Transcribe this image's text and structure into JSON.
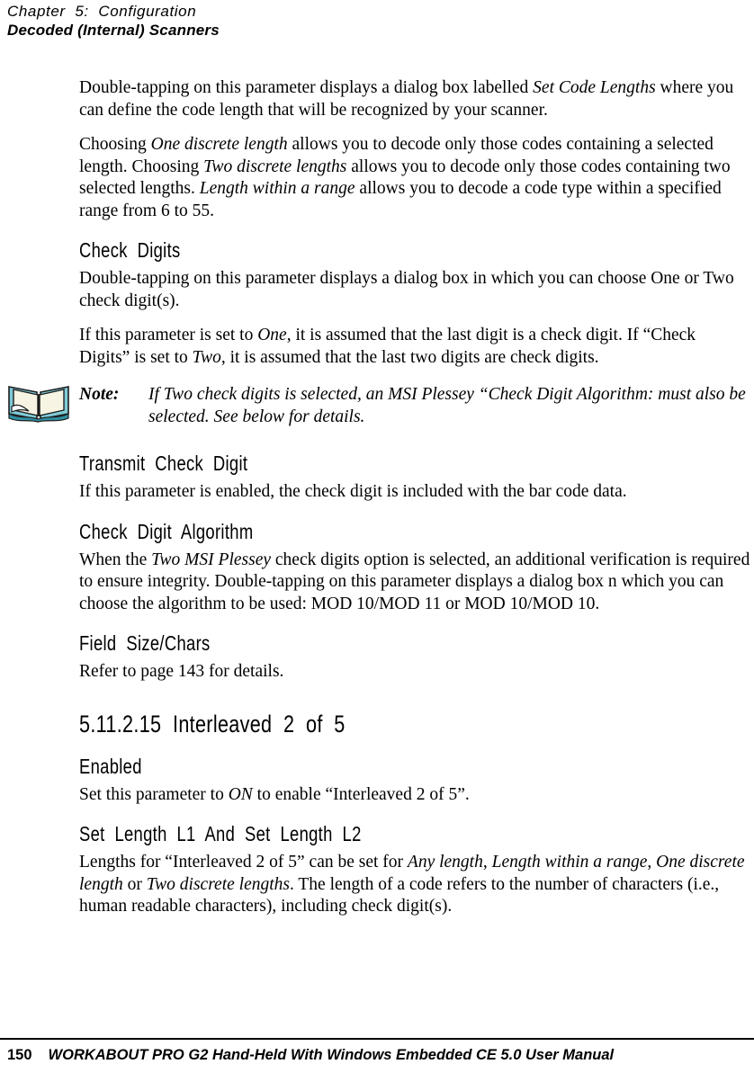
{
  "header": {
    "chapter": "Chapter  5:  Configuration",
    "subject": "Decoded (Internal) Scanners"
  },
  "content": {
    "intro_paragraph_1": {
      "part1": "Double-tapping on this parameter displays a dialog box labelled ",
      "em1": "Set Code Lengths",
      "part2": " where you can define the code length that will be recognized by your scanner."
    },
    "intro_paragraph_2": {
      "part1": "Choosing ",
      "em1": "One discrete length",
      "part2": " allows you to decode only those codes containing a selected length. Choosing ",
      "em2": "Two discrete lengths",
      "part3": " allows you to decode only those codes containing two selected lengths. ",
      "em3": "Length within a range",
      "part4": " allows you to decode a code type within a specified range from 6 to 55."
    },
    "check_digits": {
      "heading": "Check  Digits",
      "paragraph_1": "Double-tapping on this parameter displays a dialog box in which you can choose One or Two check digit(s).",
      "paragraph_2": {
        "part1": "If this parameter is set to ",
        "em1": "One",
        "part2": ", it is assumed that the last digit is a check digit. If “Check Digits” is set to ",
        "em2": "Two",
        "part3": ", it is assumed that the last two digits are check digits."
      }
    },
    "note": {
      "icon": "open-book-icon",
      "label": "Note:",
      "text": "If Two check digits is selected, an MSI Plessey “Check Digit Algorithm: must also be selected. See below for details."
    },
    "transmit_check_digit": {
      "heading": "Transmit  Check  Digit",
      "paragraph": "If this parameter is enabled, the check digit is included with the bar code data."
    },
    "check_digit_algorithm": {
      "heading": "Check  Digit  Algorithm",
      "paragraph": {
        "part1": "When the ",
        "em1": "Two MSI Plessey",
        "part2": " check digits option is selected, an additional verification is required to ensure integrity. Double-tapping on this parameter displays a dialog box n which you can choose the algorithm to be used:  MOD 10/MOD 11 or MOD 10/MOD 10."
      }
    },
    "field_size_chars": {
      "heading": "Field  Size/Chars",
      "paragraph": "Refer to page 143 for details."
    },
    "section_interleaved": {
      "heading": "5.11.2.15  Interleaved  2  of  5"
    },
    "enabled": {
      "heading": "Enabled",
      "paragraph": {
        "part1": "Set this parameter to ",
        "em1": "ON",
        "part2": " to enable “Interleaved 2 of 5”."
      }
    },
    "set_length": {
      "heading": "Set  Length  L1  And  Set  Length  L2",
      "paragraph": {
        "part1": "Lengths for “Interleaved 2 of 5” can be set for ",
        "em1": "Any length",
        "part2": ", ",
        "em2": "Length within a range",
        "part3": ", ",
        "em3": "One discrete length",
        "part4": " or ",
        "em4": "Two discrete lengths",
        "part5": ". The length of a code refers to the number of characters (i.e., human readable characters), including check digit(s)."
      }
    }
  },
  "footer": {
    "page_number": "150",
    "title": "WORKABOUT PRO G2 Hand-Held With Windows Embedded CE 5.0 User Manual"
  },
  "colors": {
    "text": "#000000",
    "page_background": "#ffffff",
    "book_cover": "#7fcbd8",
    "book_cover_dark": "#2f8fa3",
    "book_page": "#f7f4e4"
  }
}
